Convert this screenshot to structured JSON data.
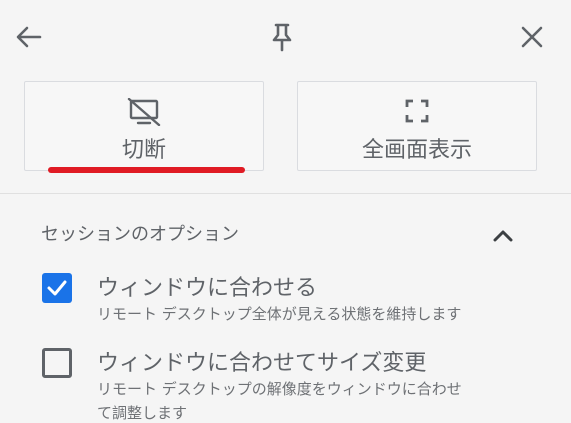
{
  "topbar": {
    "back_icon": "arrow-left-icon",
    "pin_icon": "pin-icon",
    "close_icon": "close-icon"
  },
  "actions": {
    "disconnect": {
      "label": "切断",
      "icon": "desktop-off-icon"
    },
    "fullscreen": {
      "label": "全画面表示",
      "icon": "fullscreen-icon"
    }
  },
  "session_options": {
    "title": "セッションのオプション",
    "collapse_icon": "chevron-up-icon",
    "options": [
      {
        "label": "ウィンドウに合わせる",
        "description": "リモート デスクトップ全体が見える状態を維持します",
        "checked": true
      },
      {
        "label": "ウィンドウに合わせてサイズ変更",
        "description": "リモート デスクトップの解像度をウィンドウに合わせ",
        "description_cont": "て調整します",
        "checked": false
      }
    ]
  },
  "colors": {
    "accent": "#1a73e8",
    "highlight_underline": "#e01b24",
    "text": "#5f6368",
    "background": "#f5f5f5"
  }
}
